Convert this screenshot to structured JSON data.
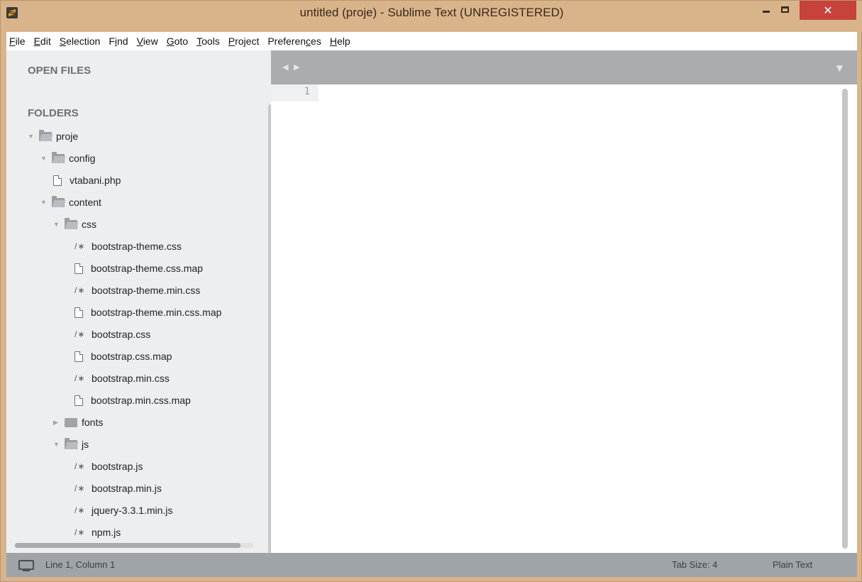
{
  "window": {
    "title": "untitled (proje) - Sublime Text (UNREGISTERED)",
    "close_glyph": "✕"
  },
  "menu": {
    "items": [
      "File",
      "Edit",
      "Selection",
      "Find",
      "View",
      "Goto",
      "Tools",
      "Project",
      "Preferences",
      "Help"
    ]
  },
  "sidebar": {
    "open_files_header": "OPEN FILES",
    "folders_header": "FOLDERS",
    "tree": [
      {
        "label": "proje",
        "kind": "folder-open",
        "depth": 0
      },
      {
        "label": "config",
        "kind": "folder-open",
        "depth": 1
      },
      {
        "label": "vtabani.php",
        "kind": "file",
        "depth": 2
      },
      {
        "label": "content",
        "kind": "folder-open",
        "depth": 1
      },
      {
        "label": "css",
        "kind": "folder-open",
        "depth": 2
      },
      {
        "label": "bootstrap-theme.css",
        "kind": "css",
        "depth": 3
      },
      {
        "label": "bootstrap-theme.css.map",
        "kind": "file",
        "depth": 3
      },
      {
        "label": "bootstrap-theme.min.css",
        "kind": "css",
        "depth": 3
      },
      {
        "label": "bootstrap-theme.min.css.map",
        "kind": "file",
        "depth": 3
      },
      {
        "label": "bootstrap.css",
        "kind": "css",
        "depth": 3
      },
      {
        "label": "bootstrap.css.map",
        "kind": "file",
        "depth": 3
      },
      {
        "label": "bootstrap.min.css",
        "kind": "css",
        "depth": 3
      },
      {
        "label": "bootstrap.min.css.map",
        "kind": "file",
        "depth": 3
      },
      {
        "label": "fonts",
        "kind": "folder-closed",
        "depth": 2
      },
      {
        "label": "js",
        "kind": "folder-open",
        "depth": 2
      },
      {
        "label": "bootstrap.js",
        "kind": "css",
        "depth": 3
      },
      {
        "label": "bootstrap.min.js",
        "kind": "css",
        "depth": 3
      },
      {
        "label": "jquery-3.3.1.min.js",
        "kind": "css",
        "depth": 3
      },
      {
        "label": "npm.js",
        "kind": "css",
        "depth": 3
      }
    ],
    "css_glyph": "/∗",
    "expanded_glyph": "▼",
    "collapsed_glyph": "▶"
  },
  "tabbar": {
    "nav_glyph": "◀ ▶",
    "dropdown_glyph": "▼"
  },
  "editor": {
    "line_number": "1"
  },
  "statusbar": {
    "position": "Line 1, Column 1",
    "tab_size": "Tab Size: 4",
    "syntax": "Plain Text"
  }
}
